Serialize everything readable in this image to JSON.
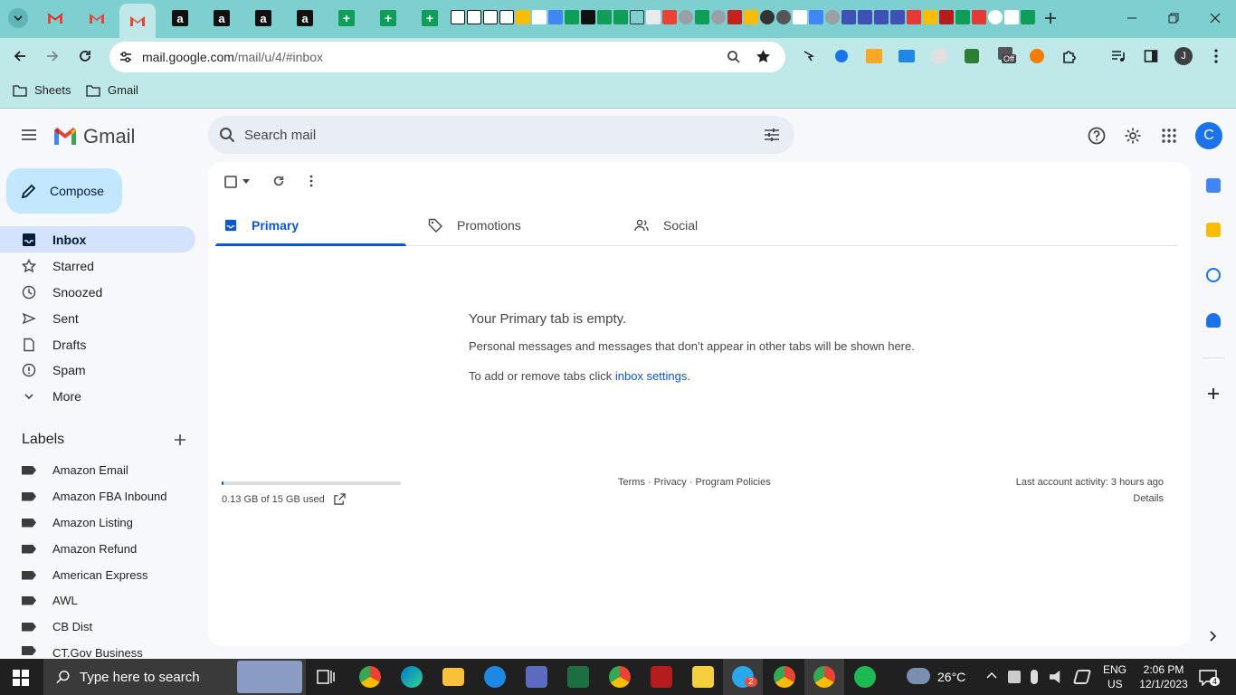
{
  "browser": {
    "url_host": "mail.google.com",
    "url_path": "/mail/u/4/#inbox",
    "bookmarks": [
      {
        "label": "Sheets"
      },
      {
        "label": "Gmail"
      }
    ],
    "profile_initial": "J",
    "coupon_badge": "Off"
  },
  "gmail": {
    "product_name": "Gmail",
    "search_placeholder": "Search mail",
    "account_initial": "C",
    "compose_label": "Compose",
    "nav": [
      {
        "label": "Inbox",
        "icon": "inbox-icon"
      },
      {
        "label": "Starred",
        "icon": "star-icon"
      },
      {
        "label": "Snoozed",
        "icon": "clock-icon"
      },
      {
        "label": "Sent",
        "icon": "send-icon"
      },
      {
        "label": "Drafts",
        "icon": "draft-icon"
      },
      {
        "label": "Spam",
        "icon": "spam-icon"
      },
      {
        "label": "More",
        "icon": "chevron-down-icon"
      }
    ],
    "labels_title": "Labels",
    "labels": [
      "Amazon Email",
      "Amazon FBA Inbound",
      "Amazon Listing",
      "Amazon Refund",
      "American Express",
      "AWL",
      "CB Dist",
      "CT.Gov Business"
    ],
    "tabs": [
      {
        "label": "Primary",
        "icon": "inbox-icon"
      },
      {
        "label": "Promotions",
        "icon": "tag-icon"
      },
      {
        "label": "Social",
        "icon": "people-icon"
      }
    ],
    "empty": {
      "title": "Your Primary tab is empty.",
      "line1": "Personal messages and messages that don’t appear in other tabs will be shown here.",
      "line2_prefix": "To add or remove tabs click ",
      "line2_link": "inbox settings",
      "line2_suffix": "."
    },
    "footer": {
      "storage": "0.13 GB of 15 GB used",
      "storage_fraction": 0.009,
      "links": "Terms · Privacy · Program Policies",
      "activity": "Last account activity: 3 hours ago",
      "details": "Details"
    }
  },
  "taskbar": {
    "search_placeholder": "Type here to search",
    "weather": "26°C",
    "lang": "ENG",
    "region": "US",
    "time": "2:06 PM",
    "date": "12/1/2023",
    "notifications": "4",
    "telegram_badge": "2"
  },
  "colors": {
    "chrome_tabstrip": "#7ecfcf",
    "chrome_toolbar": "#bfe8e8",
    "gmail_bg": "#f6f8fc",
    "compose_bg": "#c2e7ff",
    "active_nav": "#d3e3fd",
    "accent_blue": "#0b57d0"
  }
}
